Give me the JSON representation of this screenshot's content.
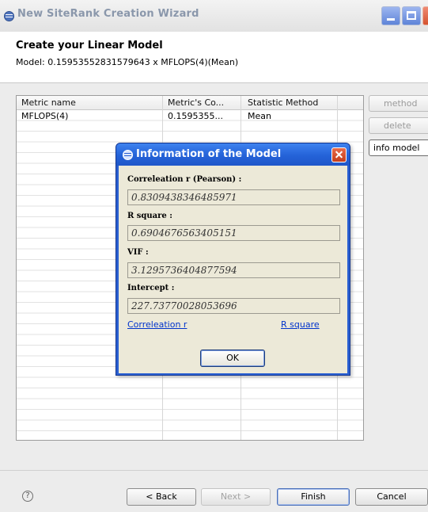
{
  "window": {
    "title": "New SiteRank Creation Wizard"
  },
  "header": {
    "title": "Create your Linear Model",
    "subtitle": "Model: 0.15953552831579643 x MFLOPS(4)(Mean)"
  },
  "table": {
    "columns": [
      "Metric name",
      "Metric's Co...",
      "Statistic Method"
    ],
    "rows": [
      [
        "MFLOPS(4)",
        "0.1595355...",
        "Mean"
      ]
    ]
  },
  "side_buttons": {
    "method": "method",
    "delete": "delete",
    "info_model": "info model"
  },
  "dialog": {
    "title": "Information of the Model",
    "fields": [
      {
        "label": "Correleation r (Pearson) :",
        "value": "0.8309438346485971"
      },
      {
        "label": "R square :",
        "value": "0.6904676563405151"
      },
      {
        "label": "VIF :",
        "value": "3.1295736404877594"
      },
      {
        "label": "Intercept :",
        "value": "227.73770028053696"
      }
    ],
    "links": {
      "correlation": "Correleation r",
      "rsquare": "R square"
    },
    "ok_label": "OK"
  },
  "footer": {
    "help": "?",
    "back": "< Back",
    "next": "Next >",
    "finish": "Finish",
    "cancel": "Cancel"
  }
}
